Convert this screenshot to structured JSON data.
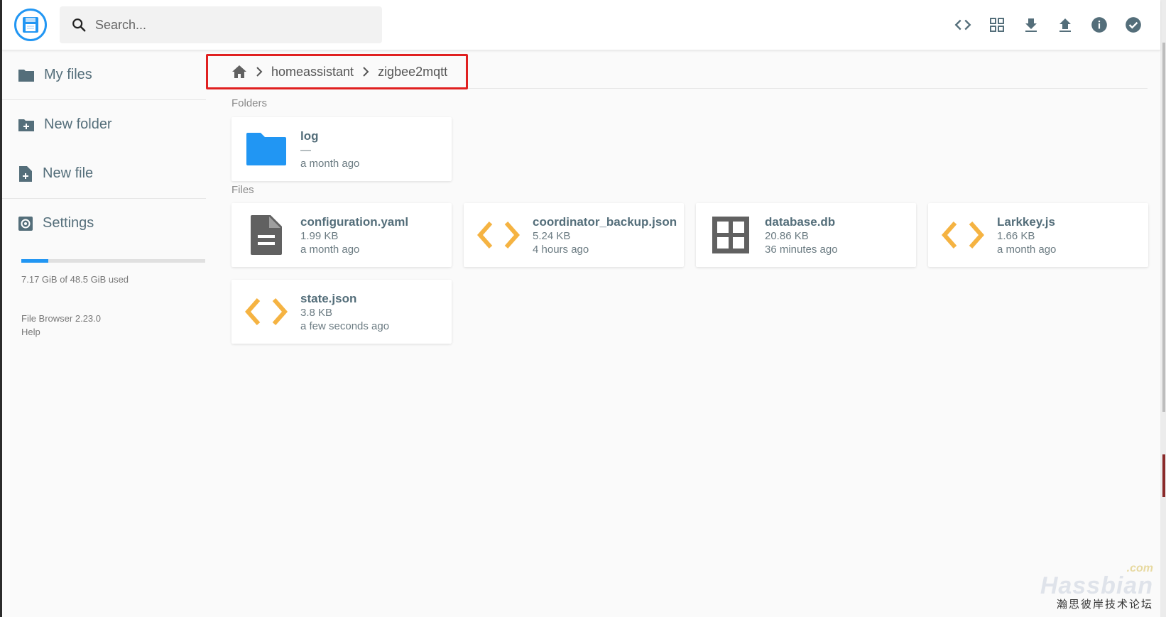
{
  "header": {
    "search_placeholder": "Search...",
    "toolbar": [
      {
        "name": "code-icon",
        "title": "Toggle code"
      },
      {
        "name": "grid-view-icon",
        "title": "Switch view"
      },
      {
        "name": "download-icon",
        "title": "Download"
      },
      {
        "name": "upload-icon",
        "title": "Upload"
      },
      {
        "name": "info-icon",
        "title": "Info"
      },
      {
        "name": "check-circle-icon",
        "title": "Select multiple"
      }
    ]
  },
  "sidebar": {
    "items": [
      {
        "label": "My files",
        "icon": "folder-icon"
      },
      {
        "label": "New folder",
        "icon": "create-folder-icon"
      },
      {
        "label": "New file",
        "icon": "note-add-icon"
      },
      {
        "label": "Settings",
        "icon": "settings-icon"
      }
    ],
    "storage": {
      "used_fraction": 0.148,
      "text": "7.17 GiB of 48.5 GiB used"
    },
    "version": "File Browser 2.23.0",
    "help": "Help"
  },
  "breadcrumb": {
    "home_icon": "home-icon",
    "items": [
      "homeassistant",
      "zigbee2mqtt"
    ]
  },
  "sections": {
    "folders_title": "Folders",
    "files_title": "Files"
  },
  "folders": [
    {
      "name": "log",
      "size": "—",
      "modified": "a month ago",
      "icon": "folder-icon"
    }
  ],
  "files": [
    {
      "name": "configuration.yaml",
      "size": "1.99 KB",
      "modified": "a month ago",
      "icon": "document-icon"
    },
    {
      "name": "coordinator_backup.json",
      "size": "5.24 KB",
      "modified": "4 hours ago",
      "icon": "code-icon"
    },
    {
      "name": "database.db",
      "size": "20.86 KB",
      "modified": "36 minutes ago",
      "icon": "grid-icon"
    },
    {
      "name": "Larkkey.js",
      "size": "1.66 KB",
      "modified": "a month ago",
      "icon": "code-icon"
    },
    {
      "name": "state.json",
      "size": "3.8 KB",
      "modified": "a few seconds ago",
      "icon": "code-icon"
    }
  ],
  "colors": {
    "accent": "#2196f3",
    "code_icon": "#f5b342",
    "highlight_box": "#e02020",
    "icon_gray": "#616161"
  },
  "watermark": {
    "com": ".com",
    "main": "Hassbian",
    "sub": "瀚思彼岸技术论坛"
  }
}
